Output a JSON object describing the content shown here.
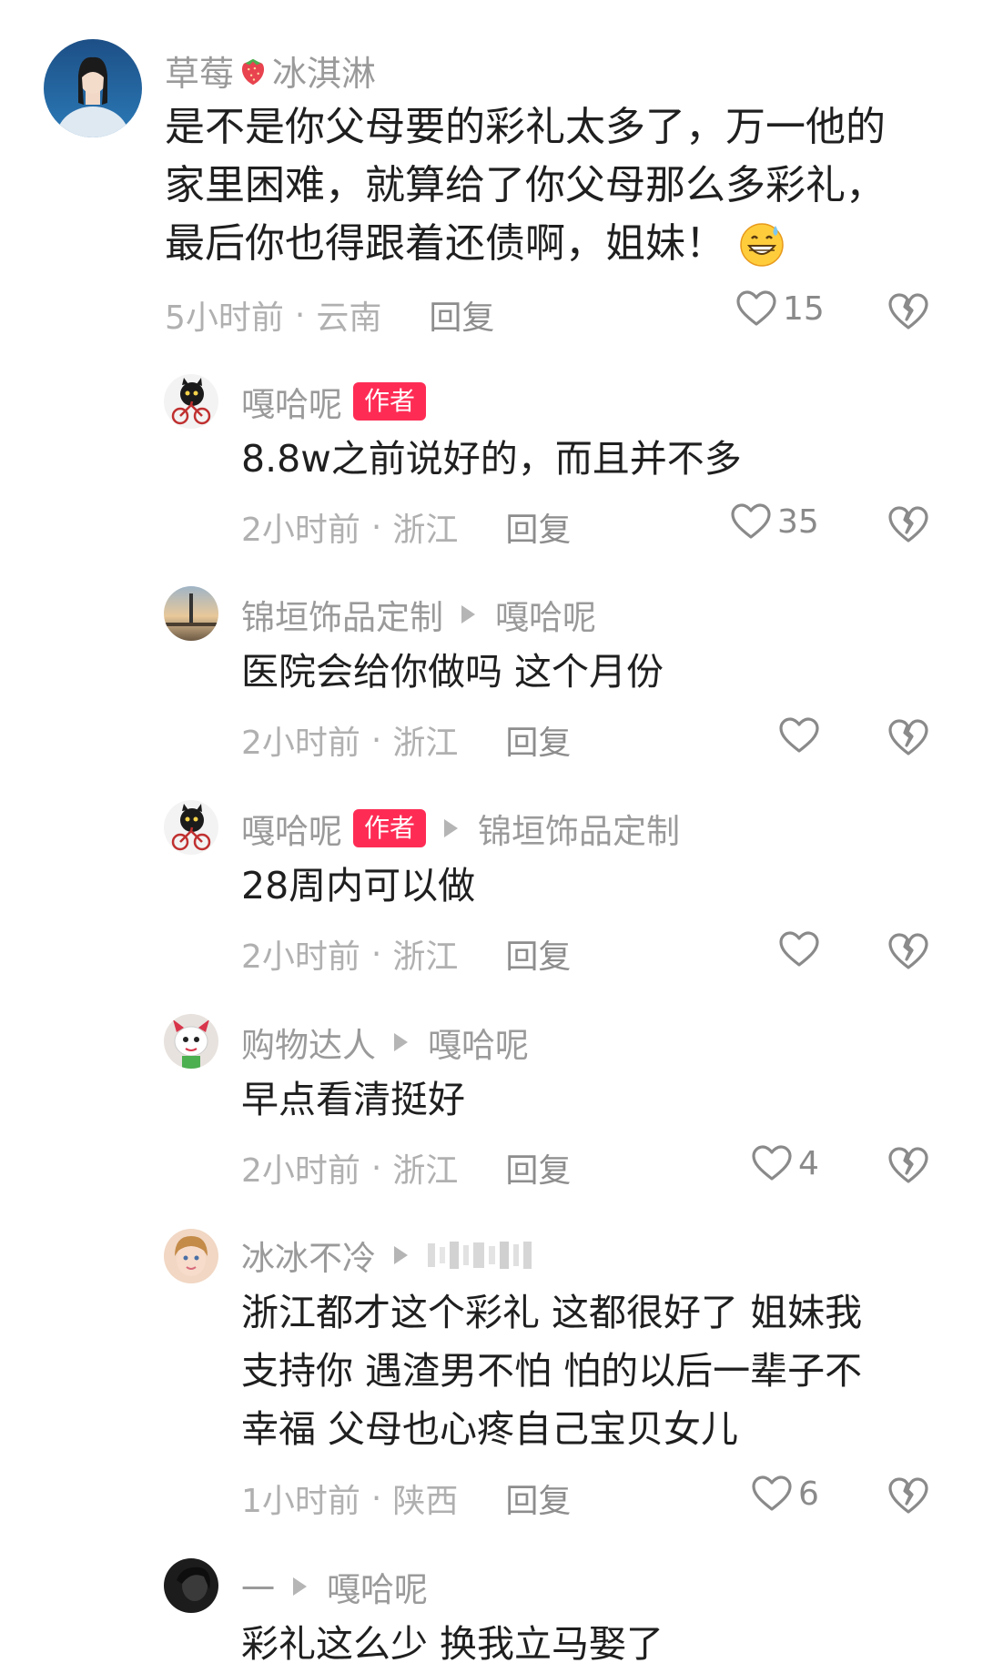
{
  "comments": [
    {
      "author": "草莓",
      "author_suffix": "冰淇淋",
      "author_emoji": "strawberry-icon",
      "text_lines": [
        "是不是你父母要的彩礼太多了，万一他的",
        "家里困难，就算给了你父母那么多彩礼，",
        "最后你也得跟着还债啊，姐妹！"
      ],
      "text_emoji": "grinning-sweat-face-icon",
      "time": "5小时前",
      "location": "云南",
      "reply_label": "回复",
      "likes": "15"
    },
    {
      "author": "嘎哈呢",
      "badge": "作者",
      "text": "8.8w之前说好的，而且并不多",
      "time": "2小时前",
      "location": "浙江",
      "reply_label": "回复",
      "likes": "35"
    },
    {
      "author": "锦垣饰品定制",
      "reply_to": "嘎哈呢",
      "text": "医院会给你做吗 这个月份",
      "time": "2小时前",
      "location": "浙江",
      "reply_label": "回复",
      "likes": ""
    },
    {
      "author": "嘎哈呢",
      "badge": "作者",
      "reply_to": "锦垣饰品定制",
      "text": "28周内可以做",
      "time": "2小时前",
      "location": "浙江",
      "reply_label": "回复",
      "likes": ""
    },
    {
      "author": "购物达人",
      "reply_to": "嘎哈呢",
      "text": "早点看清挺好",
      "time": "2小时前",
      "location": "浙江",
      "reply_label": "回复",
      "likes": "4"
    },
    {
      "author": "冰冰不冷",
      "reply_to_redacted": true,
      "text_lines": [
        "浙江都才这个彩礼 这都很好了 姐妹我",
        "支持你 遇渣男不怕 怕的以后一辈子不",
        "幸福 父母也心疼自己宝贝女儿"
      ],
      "time": "1小时前",
      "location": "陕西",
      "reply_label": "回复",
      "likes": "6"
    },
    {
      "author": "一",
      "reply_to": "嘎哈呢",
      "text": "彩礼这么少 换我立马娶了"
    }
  ],
  "meta_separator": "·",
  "colors": {
    "author_badge": "#fe2c55",
    "name_gray": "#9a9a9a",
    "text_dark": "#1f1f1f"
  }
}
